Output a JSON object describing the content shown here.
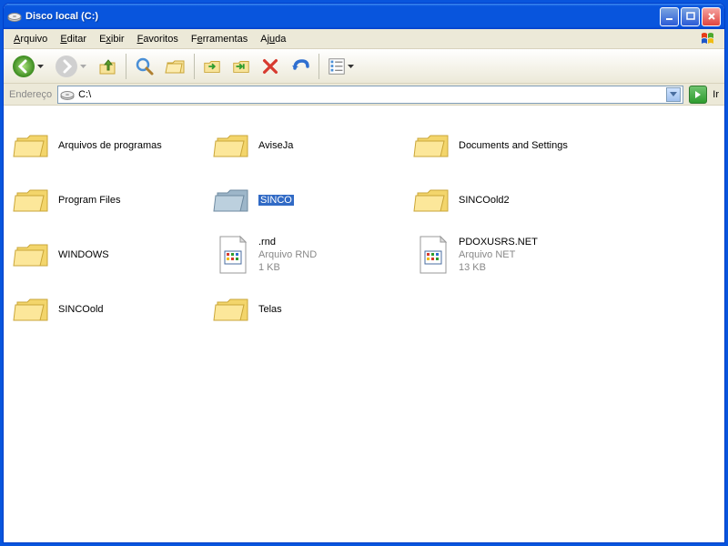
{
  "window": {
    "title": "Disco local (C:)"
  },
  "menu": {
    "arquivo": "Arquivo",
    "editar": "Editar",
    "exibir": "Exibir",
    "favoritos": "Favoritos",
    "ferramentas": "Ferramentas",
    "ajuda": "Ajuda"
  },
  "address": {
    "label": "Endereço",
    "path": "C:\\",
    "go": "Ir"
  },
  "items": [
    {
      "name": "Arquivos de programas",
      "type": "folder"
    },
    {
      "name": "AviseJa",
      "type": "folder"
    },
    {
      "name": "Documents and Settings",
      "type": "folder"
    },
    {
      "name": "Program Files",
      "type": "folder"
    },
    {
      "name": "SINCO",
      "type": "folder",
      "selected": true,
      "open": true
    },
    {
      "name": "SINCOold2",
      "type": "folder"
    },
    {
      "name": "WINDOWS",
      "type": "folder"
    },
    {
      "name": ".rnd",
      "type": "file",
      "desc": "Arquivo RND",
      "size": "1 KB"
    },
    {
      "name": "PDOXUSRS.NET",
      "type": "file",
      "desc": "Arquivo NET",
      "size": "13 KB"
    },
    {
      "name": "SINCOold",
      "type": "folder"
    },
    {
      "name": "Telas",
      "type": "folder"
    }
  ]
}
